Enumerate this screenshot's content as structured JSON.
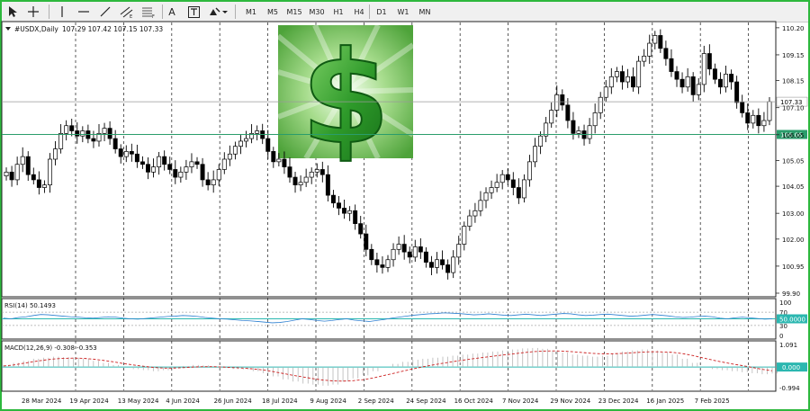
{
  "toolbar": {
    "tools": [
      {
        "name": "cursor-icon"
      },
      {
        "name": "crosshair-icon"
      },
      {
        "name": "vertical-line-icon"
      },
      {
        "name": "horizontal-line-icon"
      },
      {
        "name": "trendline-icon"
      },
      {
        "name": "equidistant-channel-icon"
      },
      {
        "name": "fibonacci-icon"
      },
      {
        "name": "text-icon"
      },
      {
        "name": "text-label-icon"
      },
      {
        "name": "shapes-icon"
      }
    ],
    "text_tool_label": "A",
    "timeframes": [
      "M1",
      "M5",
      "M15",
      "M30",
      "H1",
      "H4",
      "D1",
      "W1",
      "MN"
    ]
  },
  "chart_data": [
    {
      "type": "candlestick",
      "title": "#USDX,Daily",
      "ohlc_header": "107.29 107.42 107.15 107.33",
      "current_price_label": "107.33",
      "current_price": 107.33,
      "level_label": "106.06",
      "level": 106.06,
      "y_ticks": [
        "110.20",
        "109.15",
        "108.15",
        "107.10",
        "106.05",
        "105.05",
        "104.05",
        "103.00",
        "102.00",
        "100.95",
        "99.90"
      ],
      "ylim": [
        99.9,
        110.3
      ],
      "x_ticks": [
        "28 Mar 2024",
        "19 Apr 2024",
        "13 May 2024",
        "4 Jun 2024",
        "26 Jun 2024",
        "18 Jul 2024",
        "9 Aug 2024",
        "2 Sep 2024",
        "24 Sep 2024",
        "16 Oct 2024",
        "7 Nov 2024",
        "29 Nov 2024",
        "23 Dec 2024",
        "16 Jan 2025",
        "7 Feb 2025"
      ],
      "series": [
        {
          "values": [
            104.6,
            104.3,
            104.9,
            105.2,
            104.5,
            104.3,
            104.0,
            104.1,
            105.1,
            105.5,
            106.1,
            106.4,
            106.2,
            106.0,
            106.2,
            105.9,
            105.8,
            106.1,
            106.3,
            105.9,
            105.5,
            105.2,
            105.4,
            105.3,
            105.0,
            104.9,
            104.6,
            104.8,
            105.2,
            104.9,
            104.7,
            104.4,
            104.6,
            104.8,
            105.0,
            104.9,
            104.3,
            104.1,
            104.3,
            104.7,
            105.1,
            105.3,
            105.6,
            105.8,
            105.9,
            106.1,
            106.2,
            105.9,
            105.4,
            105.0,
            105.1,
            104.8,
            104.4,
            104.1,
            104.2,
            104.4,
            104.6,
            104.7,
            104.5,
            103.7,
            103.4,
            103.2,
            103.0,
            103.1,
            102.6,
            102.2,
            101.6,
            101.2,
            101.0,
            100.9,
            101.2,
            101.6,
            101.8,
            101.5,
            101.3,
            101.7,
            101.5,
            101.1,
            100.9,
            101.2,
            101.0,
            100.7,
            101.3,
            101.8,
            102.5,
            102.9,
            103.1,
            103.5,
            103.8,
            104.0,
            104.2,
            104.5,
            104.3,
            104.0,
            103.6,
            104.3,
            105.0,
            105.6,
            106.0,
            106.5,
            107.0,
            107.6,
            107.2,
            106.6,
            106.1,
            106.2,
            105.9,
            106.4,
            106.9,
            107.5,
            107.9,
            108.3,
            108.5,
            108.1,
            108.3,
            107.9,
            108.9,
            109.1,
            109.6,
            109.9,
            109.4,
            109.0,
            108.5,
            108.2,
            107.9,
            108.3,
            107.6,
            108.0,
            109.2,
            108.6,
            108.2,
            107.9,
            108.4,
            108.1,
            107.3,
            106.9,
            106.5,
            106.8,
            106.4,
            106.6,
            107.33
          ]
        }
      ]
    },
    {
      "type": "line",
      "label": "RSI(14) 50.1493",
      "value_label": "50.0000",
      "levels": [
        "100",
        "70",
        "50",
        "30",
        "0"
      ],
      "ylim": [
        0,
        100
      ],
      "series": [
        {
          "values": [
            52,
            50,
            54,
            56,
            60,
            63,
            62,
            60,
            58,
            56,
            55,
            53,
            52,
            54,
            56,
            55,
            52,
            50,
            49,
            51,
            53,
            55,
            57,
            58,
            60,
            59,
            57,
            54,
            52,
            50,
            49,
            47,
            45,
            44,
            42,
            40,
            38,
            39,
            42,
            46,
            50,
            48,
            45,
            43,
            45,
            48,
            50,
            46,
            44,
            42,
            45,
            48,
            52,
            55,
            58,
            61,
            63,
            65,
            66,
            68,
            67,
            66,
            64,
            62,
            63,
            65,
            63,
            61,
            60,
            62,
            64,
            62,
            60,
            62,
            64,
            66,
            65,
            62,
            60,
            61,
            63,
            64,
            62,
            60,
            58,
            59,
            61,
            63,
            61,
            59,
            56,
            54,
            55,
            57,
            58,
            56,
            52,
            50,
            53,
            55,
            53,
            51,
            49,
            50.15
          ]
        }
      ]
    },
    {
      "type": "bar+line",
      "label": "MACD(12,26,9) -0.308 -0.353",
      "value_label": "0.000",
      "levels": [
        "1.091",
        "0.000",
        "-0.994"
      ],
      "ylim": [
        -0.994,
        1.091
      ],
      "macd": [
        0.1,
        0.2,
        0.3,
        0.4,
        0.45,
        0.5,
        0.48,
        0.45,
        0.4,
        0.3,
        0.2,
        0.1,
        0.0,
        -0.1,
        -0.15,
        -0.2,
        -0.15,
        -0.05,
        0.05,
        0.1,
        0.08,
        0.02,
        -0.05,
        -0.1,
        -0.12,
        -0.2,
        -0.3,
        -0.45,
        -0.6,
        -0.7,
        -0.8,
        -0.85,
        -0.9,
        -0.85,
        -0.7,
        -0.55,
        -0.4,
        -0.2,
        0.0,
        0.15,
        0.25,
        0.35,
        0.4,
        0.45,
        0.5,
        0.55,
        0.6,
        0.65,
        0.7,
        0.75,
        0.8,
        0.85,
        0.9,
        0.92,
        0.88,
        0.8,
        0.7,
        0.6,
        0.55,
        0.5,
        0.55,
        0.65,
        0.75,
        0.8,
        0.85,
        0.8,
        0.7,
        0.6,
        0.4,
        0.2,
        0.0,
        -0.1,
        -0.15,
        -0.2,
        -0.25,
        -0.3,
        -0.35,
        -0.31
      ],
      "signal": [
        0.05,
        0.1,
        0.18,
        0.26,
        0.33,
        0.39,
        0.42,
        0.43,
        0.42,
        0.38,
        0.32,
        0.25,
        0.17,
        0.1,
        0.04,
        -0.02,
        -0.05,
        -0.05,
        -0.03,
        0.0,
        0.02,
        0.02,
        0.0,
        -0.03,
        -0.05,
        -0.09,
        -0.14,
        -0.22,
        -0.31,
        -0.4,
        -0.48,
        -0.56,
        -0.63,
        -0.67,
        -0.68,
        -0.66,
        -0.61,
        -0.53,
        -0.42,
        -0.31,
        -0.2,
        -0.09,
        0.01,
        0.1,
        0.18,
        0.26,
        0.33,
        0.4,
        0.46,
        0.52,
        0.58,
        0.63,
        0.69,
        0.74,
        0.77,
        0.78,
        0.77,
        0.74,
        0.7,
        0.66,
        0.64,
        0.64,
        0.66,
        0.69,
        0.72,
        0.74,
        0.73,
        0.71,
        0.65,
        0.56,
        0.45,
        0.34,
        0.24,
        0.15,
        0.07,
        -0.02,
        -0.11,
        -0.18
      ]
    }
  ]
}
